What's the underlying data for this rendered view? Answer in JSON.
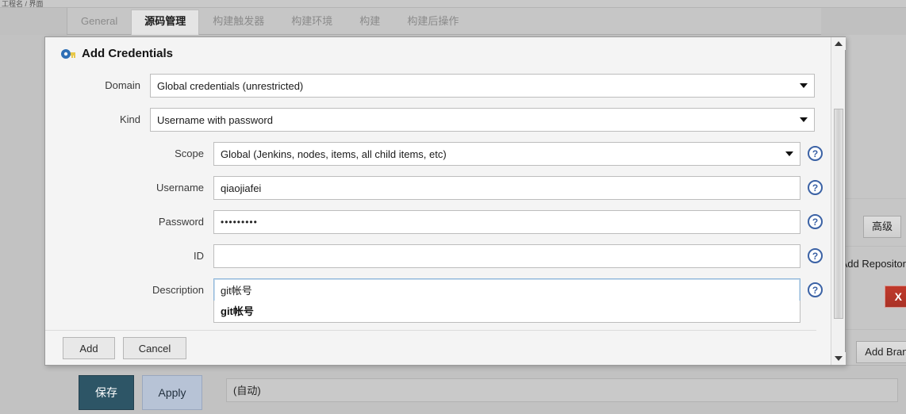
{
  "page": {
    "breadcrumb": "工程名 / 界面",
    "tabs": [
      {
        "label": "General",
        "active": false
      },
      {
        "label": "源码管理",
        "active": true
      },
      {
        "label": "构建触发器",
        "active": false
      },
      {
        "label": "构建环境",
        "active": false
      },
      {
        "label": "构建",
        "active": false
      },
      {
        "label": "构建后操作",
        "active": false
      }
    ],
    "right_panel": {
      "advanced_button": "高级",
      "add_repository_label": "Add Repositor",
      "delete_button": "X",
      "add_branch_button": "Add Branc"
    },
    "bottom_bar": {
      "save_label": "保存",
      "apply_label": "Apply",
      "auto_field_value": "(自动)"
    }
  },
  "modal": {
    "title": "Add Credentials",
    "title_icon": "key-icon",
    "rows": [
      {
        "label": "Domain",
        "type": "select",
        "value": "Global credentials (unrestricted)",
        "has_help": false,
        "level": 1
      },
      {
        "label": "Kind",
        "type": "select",
        "value": "Username with password",
        "has_help": false,
        "level": 1
      },
      {
        "label": "Scope",
        "type": "select",
        "value": "Global (Jenkins, nodes, items, all child items, etc)",
        "has_help": true,
        "level": 2
      },
      {
        "label": "Username",
        "type": "text",
        "value": "qiaojiafei",
        "has_help": true,
        "level": 2
      },
      {
        "label": "Password",
        "type": "password",
        "value": "•••••••••",
        "has_help": true,
        "level": 2
      },
      {
        "label": "ID",
        "type": "text",
        "value": "",
        "has_help": true,
        "level": 2
      },
      {
        "label": "Description",
        "type": "text",
        "value": "git帐号",
        "has_help": true,
        "level": 2,
        "focused": true
      }
    ],
    "autocomplete_suggestion": "git帐号",
    "footer": {
      "add_label": "Add",
      "cancel_label": "Cancel"
    },
    "help_icon_glyph": "?",
    "scrollbar": {
      "up_icon": "triangle-up-icon",
      "down_icon": "triangle-down-icon"
    }
  },
  "colors": {
    "page_bg": "#c0c0c0",
    "modal_bg": "#f4f4f4",
    "accent_save": "#2d5566",
    "accent_apply": "#b7c3d6",
    "danger": "#c0392b",
    "help_blue": "#3b62a5",
    "focus_border": "#8eb6da"
  }
}
